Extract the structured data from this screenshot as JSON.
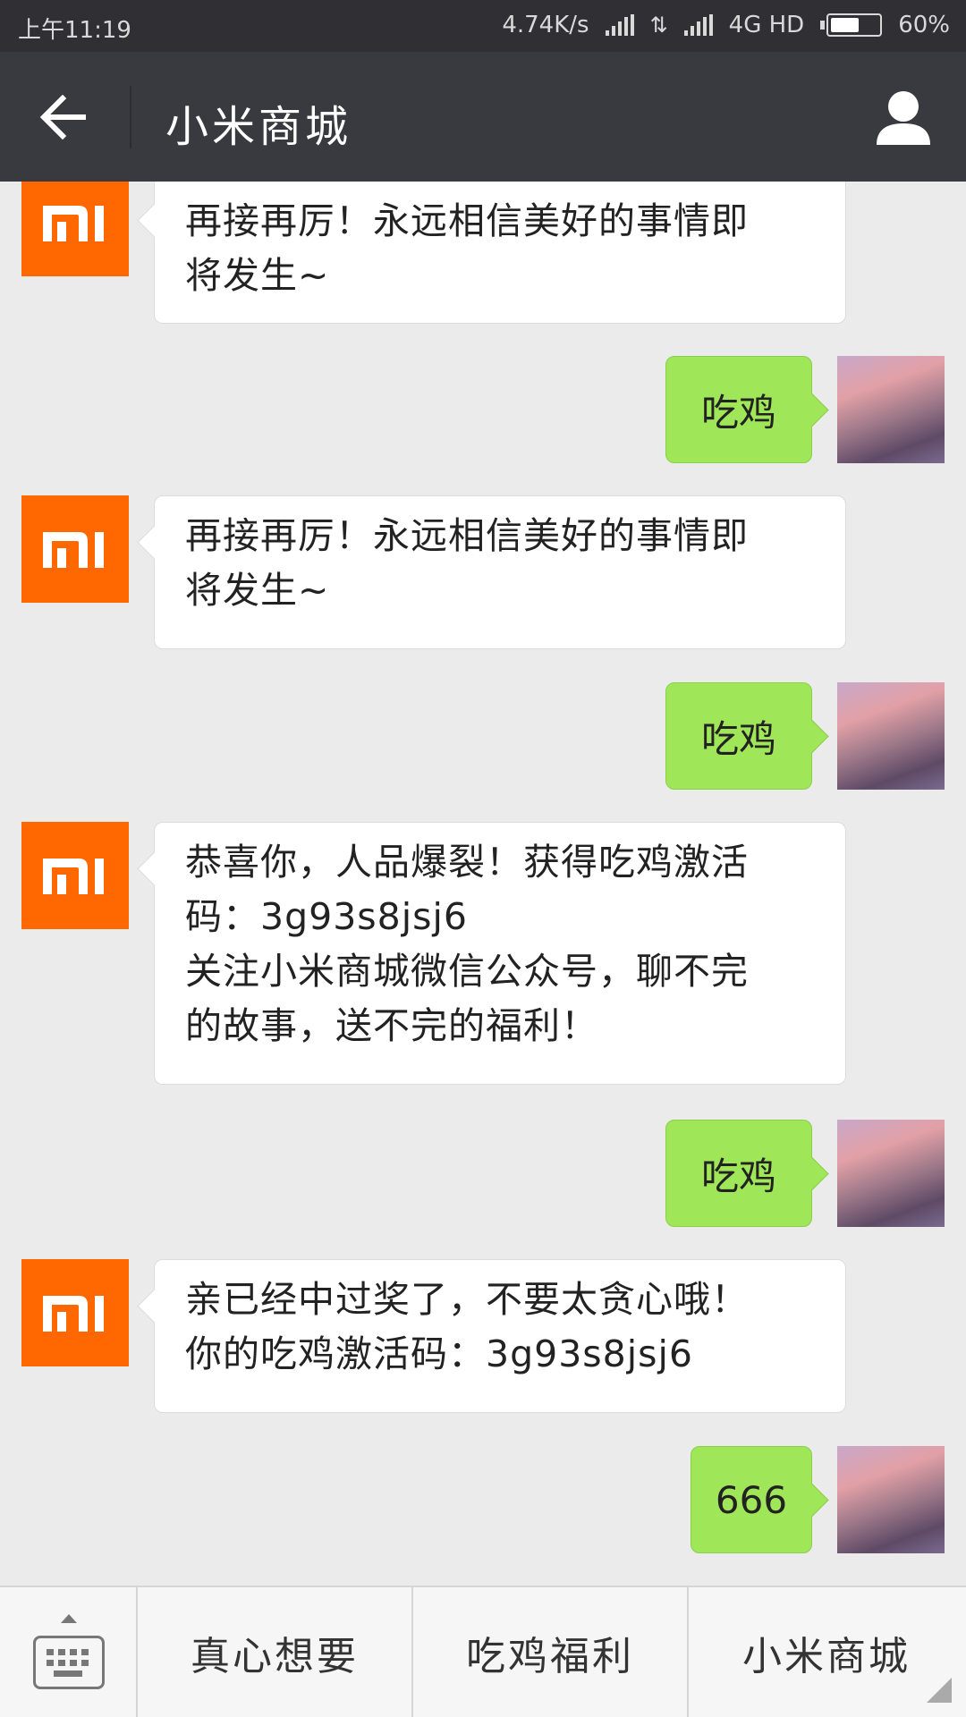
{
  "status": {
    "time": "上午11:19",
    "net_speed": "4.74K/s",
    "network": "4G HD",
    "battery": "60%",
    "battery_level": 0.6
  },
  "header": {
    "title": "小米商城",
    "back_icon": "back-arrow-icon",
    "profile_icon": "person-icon"
  },
  "messages": [
    {
      "from": "bot",
      "lines": [
        "再接再厉！永远相信美好的事情即",
        "将发生~"
      ]
    },
    {
      "from": "me",
      "text": "吃鸡"
    },
    {
      "from": "bot",
      "lines": [
        "再接再厉！永远相信美好的事情即",
        "将发生~"
      ]
    },
    {
      "from": "me",
      "text": "吃鸡"
    },
    {
      "from": "bot",
      "lines": [
        "恭喜你，人品爆裂！获得吃鸡激活",
        "码：3g93s8jsj6",
        "关注小米商城微信公众号，聊不完",
        "的故事，送不完的福利！"
      ]
    },
    {
      "from": "me",
      "text": "吃鸡"
    },
    {
      "from": "bot",
      "lines": [
        "亲已经中过奖了，不要太贪心哦！",
        "你的吃鸡激活码：3g93s8jsj6"
      ]
    },
    {
      "from": "me",
      "text": "666"
    }
  ],
  "bot_avatar_text": "mi",
  "menu": {
    "keyboard_icon": "keyboard-icon",
    "items": [
      "真心想要",
      "吃鸡福利",
      "小米商城"
    ]
  },
  "colors": {
    "accent_mi": "#ff6700",
    "bubble_out": "#9fe658",
    "header_bg": "#393a3f"
  }
}
